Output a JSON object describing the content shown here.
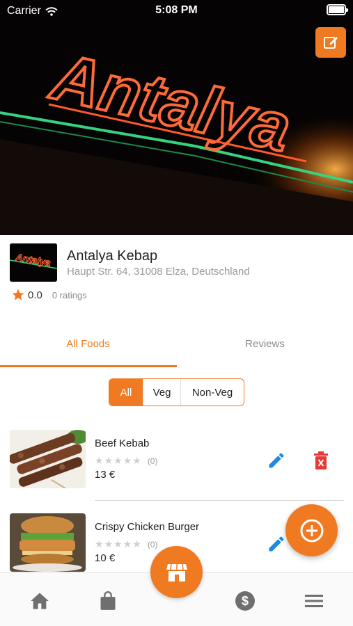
{
  "status_bar": {
    "carrier": "Carrier",
    "time": "5:08 PM"
  },
  "banner": {
    "sign_text": "Antalya"
  },
  "restaurant": {
    "name": "Antalya Kebap",
    "address": "Haupt Str. 64, 31008 Elza, Deutschland",
    "rating": "0.0",
    "ratings_count": "0 ratings",
    "logo_text": "Antalya"
  },
  "tabs": [
    {
      "label": "All Foods",
      "active": true
    },
    {
      "label": "Reviews",
      "active": false
    }
  ],
  "filter": {
    "options": [
      "All",
      "Veg",
      "Non-Veg"
    ],
    "selected": "All"
  },
  "foods": [
    {
      "name": "Beef Kebab",
      "rating_count": "(0)",
      "price": "13 €",
      "stars": 0
    },
    {
      "name": "Crispy Chicken Burger",
      "rating_count": "(0)",
      "price": "10 €",
      "stars": 0
    }
  ],
  "bottom_nav": [
    {
      "icon": "home-icon"
    },
    {
      "icon": "shopping-bag-icon"
    },
    {
      "icon": "store-icon"
    },
    {
      "icon": "dollar-icon"
    },
    {
      "icon": "menu-icon"
    }
  ],
  "colors": {
    "accent": "#ef7a22",
    "edit_blue": "#1e88e5",
    "delete_red": "#e53935",
    "star_gray": "#cfcfcf"
  }
}
